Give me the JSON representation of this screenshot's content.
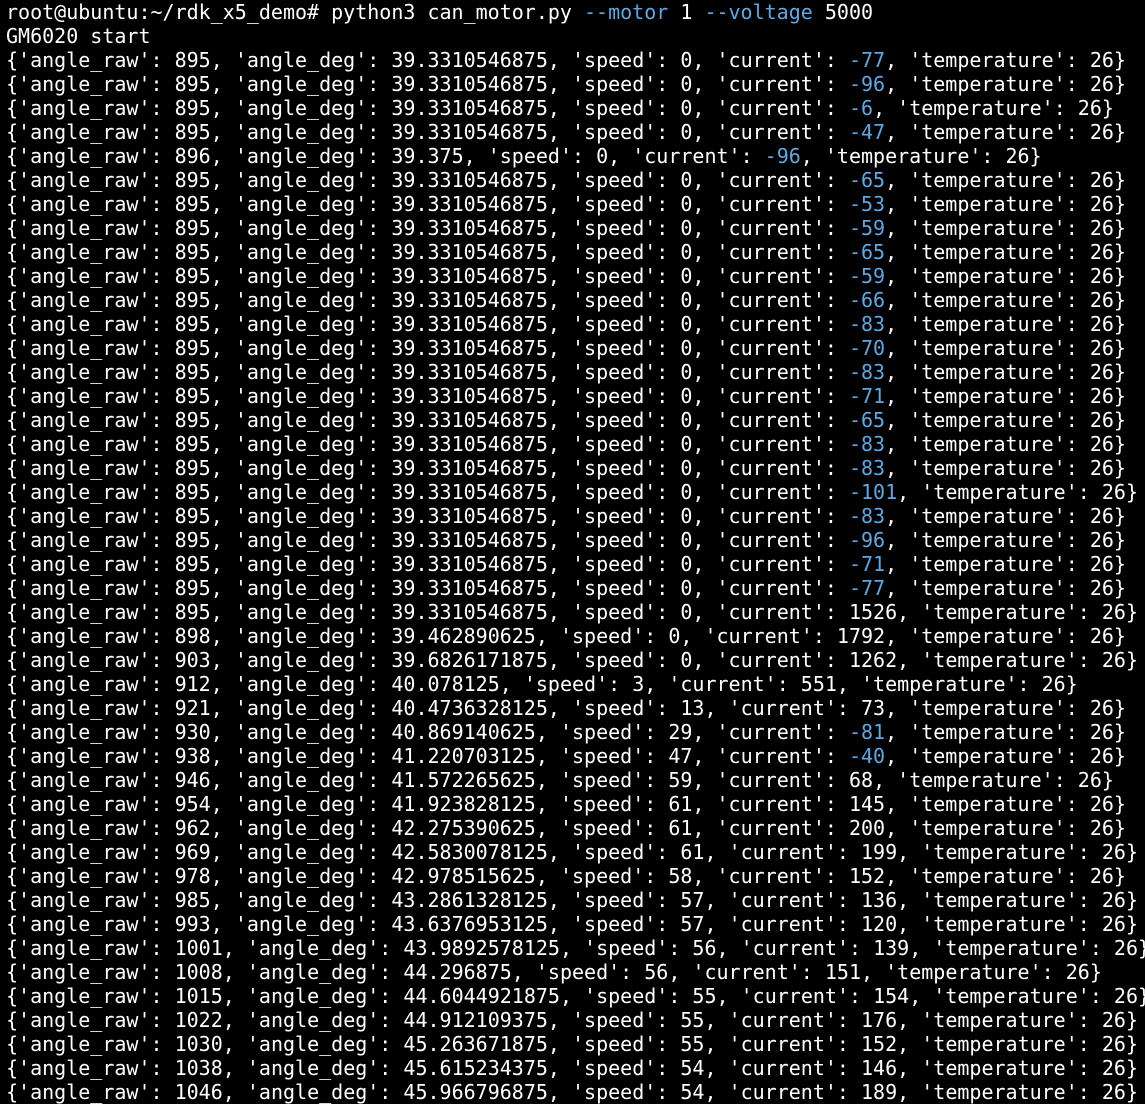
{
  "terminal": {
    "prompt": "root@ubuntu:~/rdk_x5_demo#",
    "command": {
      "program": "python3 can_motor.py",
      "args": [
        {
          "flag": "--motor",
          "value": "1"
        },
        {
          "flag": "--voltage",
          "value": "5000"
        }
      ]
    },
    "banner": "GM6020 start",
    "rows": [
      {
        "angle_raw": 895,
        "angle_deg": "39.3310546875",
        "speed": 0,
        "current": -77,
        "temperature": 26
      },
      {
        "angle_raw": 895,
        "angle_deg": "39.3310546875",
        "speed": 0,
        "current": -96,
        "temperature": 26
      },
      {
        "angle_raw": 895,
        "angle_deg": "39.3310546875",
        "speed": 0,
        "current": -6,
        "temperature": 26
      },
      {
        "angle_raw": 895,
        "angle_deg": "39.3310546875",
        "speed": 0,
        "current": -47,
        "temperature": 26
      },
      {
        "angle_raw": 896,
        "angle_deg": "39.375",
        "speed": 0,
        "current": -96,
        "temperature": 26
      },
      {
        "angle_raw": 895,
        "angle_deg": "39.3310546875",
        "speed": 0,
        "current": -65,
        "temperature": 26
      },
      {
        "angle_raw": 895,
        "angle_deg": "39.3310546875",
        "speed": 0,
        "current": -53,
        "temperature": 26
      },
      {
        "angle_raw": 895,
        "angle_deg": "39.3310546875",
        "speed": 0,
        "current": -59,
        "temperature": 26
      },
      {
        "angle_raw": 895,
        "angle_deg": "39.3310546875",
        "speed": 0,
        "current": -65,
        "temperature": 26
      },
      {
        "angle_raw": 895,
        "angle_deg": "39.3310546875",
        "speed": 0,
        "current": -59,
        "temperature": 26
      },
      {
        "angle_raw": 895,
        "angle_deg": "39.3310546875",
        "speed": 0,
        "current": -66,
        "temperature": 26
      },
      {
        "angle_raw": 895,
        "angle_deg": "39.3310546875",
        "speed": 0,
        "current": -83,
        "temperature": 26
      },
      {
        "angle_raw": 895,
        "angle_deg": "39.3310546875",
        "speed": 0,
        "current": -70,
        "temperature": 26
      },
      {
        "angle_raw": 895,
        "angle_deg": "39.3310546875",
        "speed": 0,
        "current": -83,
        "temperature": 26
      },
      {
        "angle_raw": 895,
        "angle_deg": "39.3310546875",
        "speed": 0,
        "current": -71,
        "temperature": 26
      },
      {
        "angle_raw": 895,
        "angle_deg": "39.3310546875",
        "speed": 0,
        "current": -65,
        "temperature": 26
      },
      {
        "angle_raw": 895,
        "angle_deg": "39.3310546875",
        "speed": 0,
        "current": -83,
        "temperature": 26
      },
      {
        "angle_raw": 895,
        "angle_deg": "39.3310546875",
        "speed": 0,
        "current": -83,
        "temperature": 26
      },
      {
        "angle_raw": 895,
        "angle_deg": "39.3310546875",
        "speed": 0,
        "current": -101,
        "temperature": 26
      },
      {
        "angle_raw": 895,
        "angle_deg": "39.3310546875",
        "speed": 0,
        "current": -83,
        "temperature": 26
      },
      {
        "angle_raw": 895,
        "angle_deg": "39.3310546875",
        "speed": 0,
        "current": -96,
        "temperature": 26
      },
      {
        "angle_raw": 895,
        "angle_deg": "39.3310546875",
        "speed": 0,
        "current": -71,
        "temperature": 26
      },
      {
        "angle_raw": 895,
        "angle_deg": "39.3310546875",
        "speed": 0,
        "current": -77,
        "temperature": 26
      },
      {
        "angle_raw": 895,
        "angle_deg": "39.3310546875",
        "speed": 0,
        "current": 1526,
        "temperature": 26
      },
      {
        "angle_raw": 898,
        "angle_deg": "39.462890625",
        "speed": 0,
        "current": 1792,
        "temperature": 26
      },
      {
        "angle_raw": 903,
        "angle_deg": "39.6826171875",
        "speed": 0,
        "current": 1262,
        "temperature": 26
      },
      {
        "angle_raw": 912,
        "angle_deg": "40.078125",
        "speed": 3,
        "current": 551,
        "temperature": 26
      },
      {
        "angle_raw": 921,
        "angle_deg": "40.4736328125",
        "speed": 13,
        "current": 73,
        "temperature": 26
      },
      {
        "angle_raw": 930,
        "angle_deg": "40.869140625",
        "speed": 29,
        "current": -81,
        "temperature": 26
      },
      {
        "angle_raw": 938,
        "angle_deg": "41.220703125",
        "speed": 47,
        "current": -40,
        "temperature": 26
      },
      {
        "angle_raw": 946,
        "angle_deg": "41.572265625",
        "speed": 59,
        "current": 68,
        "temperature": 26
      },
      {
        "angle_raw": 954,
        "angle_deg": "41.923828125",
        "speed": 61,
        "current": 145,
        "temperature": 26
      },
      {
        "angle_raw": 962,
        "angle_deg": "42.275390625",
        "speed": 61,
        "current": 200,
        "temperature": 26
      },
      {
        "angle_raw": 969,
        "angle_deg": "42.5830078125",
        "speed": 61,
        "current": 199,
        "temperature": 26
      },
      {
        "angle_raw": 978,
        "angle_deg": "42.978515625",
        "speed": 58,
        "current": 152,
        "temperature": 26
      },
      {
        "angle_raw": 985,
        "angle_deg": "43.2861328125",
        "speed": 57,
        "current": 136,
        "temperature": 26
      },
      {
        "angle_raw": 993,
        "angle_deg": "43.6376953125",
        "speed": 57,
        "current": 120,
        "temperature": 26
      },
      {
        "angle_raw": 1001,
        "angle_deg": "43.9892578125",
        "speed": 56,
        "current": 139,
        "temperature": 26
      },
      {
        "angle_raw": 1008,
        "angle_deg": "44.296875",
        "speed": 56,
        "current": 151,
        "temperature": 26
      },
      {
        "angle_raw": 1015,
        "angle_deg": "44.6044921875",
        "speed": 55,
        "current": 154,
        "temperature": 26
      },
      {
        "angle_raw": 1022,
        "angle_deg": "44.912109375",
        "speed": 55,
        "current": 176,
        "temperature": 26
      },
      {
        "angle_raw": 1030,
        "angle_deg": "45.263671875",
        "speed": 55,
        "current": 152,
        "temperature": 26
      },
      {
        "angle_raw": 1038,
        "angle_deg": "45.615234375",
        "speed": 54,
        "current": 146,
        "temperature": 26
      },
      {
        "angle_raw": 1046,
        "angle_deg": "45.966796875",
        "speed": 54,
        "current": 189,
        "temperature": 26
      }
    ]
  },
  "colors": {
    "background": "#000000",
    "foreground": "#ffffff",
    "highlight": "#5aa9e6"
  }
}
